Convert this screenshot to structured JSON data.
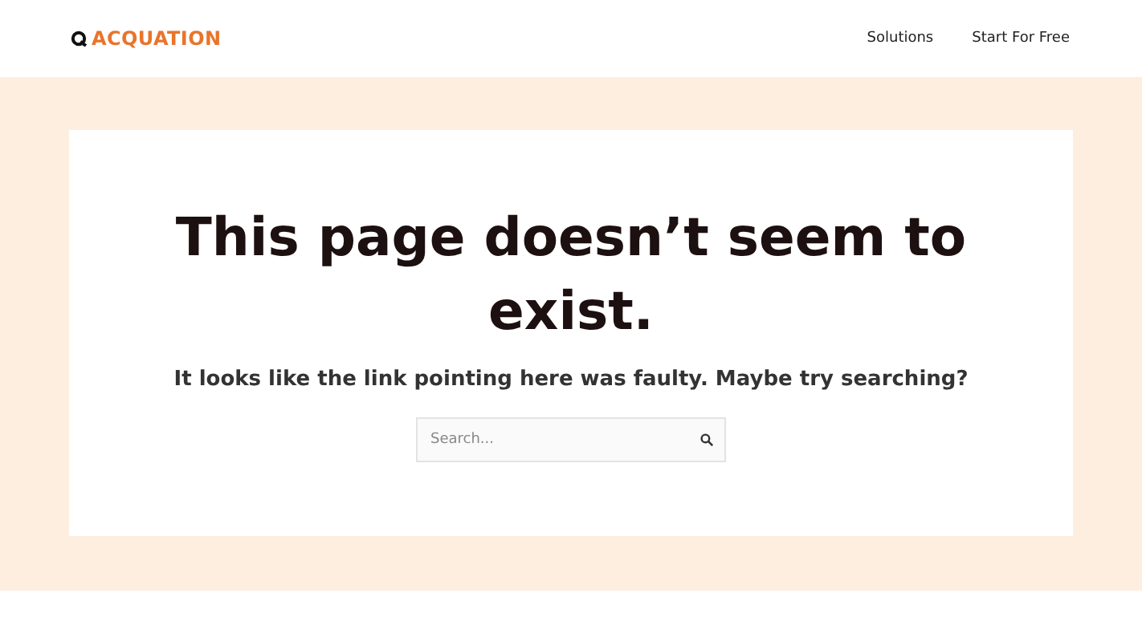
{
  "header": {
    "logo": "ACQUATION",
    "nav": [
      "Solutions",
      "Start For Free"
    ]
  },
  "main": {
    "title": "This page doesn’t seem to exist.",
    "subtitle": "It looks like the link pointing here was faulty. Maybe try searching?",
    "search": {
      "placeholder": "Search..."
    }
  }
}
